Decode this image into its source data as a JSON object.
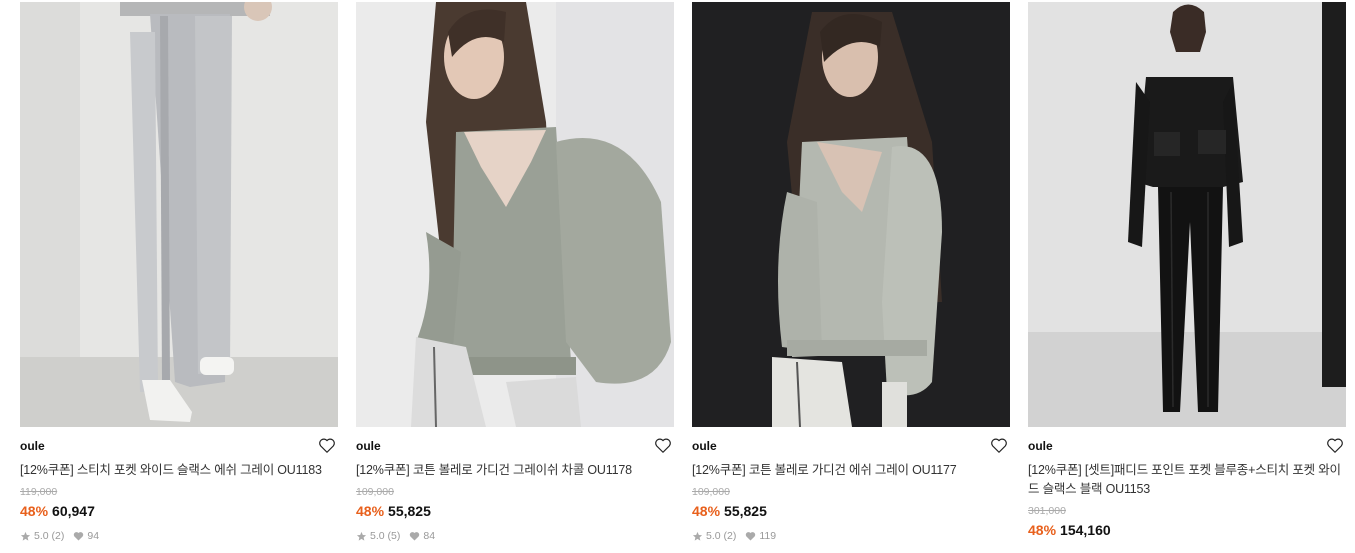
{
  "products": [
    {
      "brand": "oule",
      "title": "[12%쿠폰] 스티치 포켓 와이드 슬랙스 에쉬 그레이 OU1183",
      "original_price": "119,000",
      "discount": "48%",
      "price": "60,947",
      "rating": "5.0",
      "reviews": "(2)",
      "likes": "94"
    },
    {
      "brand": "oule",
      "title": "[12%쿠폰] 코튼 볼레로 가디건 그레이쉬 차콜 OU1178",
      "original_price": "109,000",
      "discount": "48%",
      "price": "55,825",
      "rating": "5.0",
      "reviews": "(5)",
      "likes": "84"
    },
    {
      "brand": "oule",
      "title": "[12%쿠폰] 코튼 볼레로 가디건 에쉬 그레이 OU1177",
      "original_price": "109,000",
      "discount": "48%",
      "price": "55,825",
      "rating": "5.0",
      "reviews": "(2)",
      "likes": "119"
    },
    {
      "brand": "oule",
      "title": "[12%쿠폰] [셋트]패디드 포인트 포켓 블루종+스티치 포켓 와이드 슬랙스 블랙 OU1153",
      "original_price": "301,000",
      "discount": "48%",
      "price": "154,160"
    }
  ],
  "colors": {
    "discount": "#e8601c",
    "muted": "#999999",
    "strike": "#aaaaaa"
  },
  "icons": {
    "wishlist": "heart-outline-icon",
    "rating": "star-icon",
    "likes": "heart-filled-icon"
  }
}
